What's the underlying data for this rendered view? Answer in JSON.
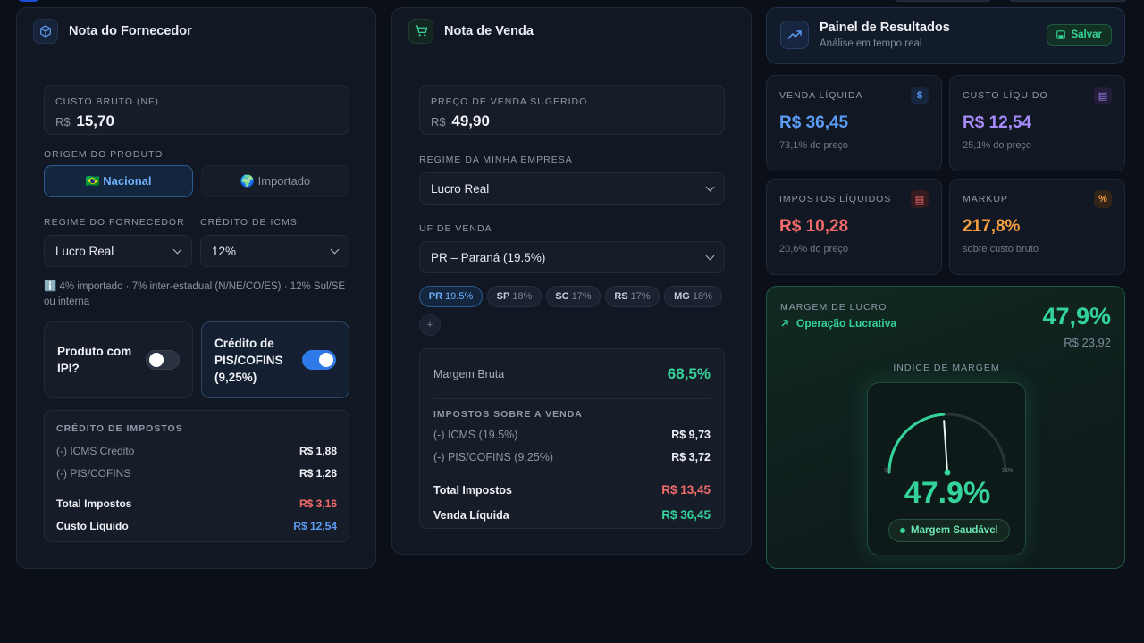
{
  "supplier": {
    "title": "Nota do Fornecedor",
    "gross_cost_label": "CUSTO BRUTO (NF)",
    "currency": "R$",
    "gross_cost_value": "15,70",
    "origin_label": "ORIGEM DO PRODUTO",
    "origin_options": [
      "🇧🇷 Nacional",
      "🌍 Importado"
    ],
    "regime_label": "REGIME DO FORNECEDOR",
    "regime_value": "Lucro Real",
    "icms_label": "CRÉDITO DE ICMS",
    "icms_value": "12%",
    "info_text": "ℹ️ 4% importado · 7% inter-estadual (N/NE/CO/ES) · 12% Sul/SE ou interna",
    "ipi_label": "Produto com IPI?",
    "pis_label": "Crédito de PIS/COFINS (9,25%)",
    "credits": {
      "title": "CRÉDITO DE IMPOSTOS",
      "rows": [
        {
          "label": "(-) ICMS Crédito",
          "value": "R$ 1,88"
        },
        {
          "label": "(-) PIS/COFINS",
          "value": "R$ 1,28"
        }
      ],
      "total_label": "Total Impostos",
      "total_value": "R$ 3,16",
      "net_label": "Custo Líquido",
      "net_value": "R$ 12,54"
    }
  },
  "sale": {
    "title": "Nota de Venda",
    "price_label": "PREÇO DE VENDA SUGERIDO",
    "currency": "R$",
    "price_value": "49,90",
    "regime_label": "REGIME DA MINHA EMPRESA",
    "regime_value": "Lucro Real",
    "uf_label": "UF DE VENDA",
    "uf_value": "PR – Paraná (19.5%)",
    "uf_chips": [
      {
        "code": "PR",
        "pct": "19.5%"
      },
      {
        "code": "SP",
        "pct": "18%"
      },
      {
        "code": "SC",
        "pct": "17%"
      },
      {
        "code": "RS",
        "pct": "17%"
      },
      {
        "code": "MG",
        "pct": "18%"
      }
    ],
    "add_chip": "+",
    "gross_margin_label": "Margem Bruta",
    "gross_margin_value": "68,5%",
    "taxes_title": "IMPOSTOS SOBRE A VENDA",
    "tax_rows": [
      {
        "label": "(-) ICMS (19.5%)",
        "value": "R$ 9,73"
      },
      {
        "label": "(-) PIS/COFINS (9,25%)",
        "value": "R$ 3,72"
      }
    ],
    "total_label": "Total Impostos",
    "total_value": "R$ 13,45",
    "net_label": "Venda Líquida",
    "net_value": "R$ 36,45"
  },
  "results": {
    "title": "Painel de Resultados",
    "subtitle": "Análise em tempo real",
    "save_label": "Salvar",
    "metrics": [
      {
        "label": "VENDA LÍQUIDA",
        "value": "R$ 36,45",
        "sub": "73,1% do preço",
        "icon": "$",
        "color": "#5b9cf5"
      },
      {
        "label": "CUSTO LÍQUIDO",
        "value": "R$ 12,54",
        "sub": "25,1% do preço",
        "icon": "▤",
        "color": "#a78bfa"
      },
      {
        "label": "IMPOSTOS LÍQUIDOS",
        "value": "R$ 10,28",
        "sub": "20,6% do preço",
        "icon": "▤",
        "color": "#f26b6b"
      },
      {
        "label": "MARKUP",
        "value": "217,8%",
        "sub": "sobre custo bruto",
        "icon": "%",
        "color": "#f59e42"
      }
    ],
    "margin_label": "MARGEM DE LUCRO",
    "margin_status": "Operação Lucrativa",
    "margin_value": "47,9%",
    "margin_amount": "R$ 23,92",
    "gauge_title": "ÍNDICE DE MARGEM",
    "gauge_value": "47.9%",
    "gauge_fraction": 0.479,
    "gauge_min": "0%",
    "gauge_max": "100%",
    "gauge_badge": "Margem Saudável"
  }
}
